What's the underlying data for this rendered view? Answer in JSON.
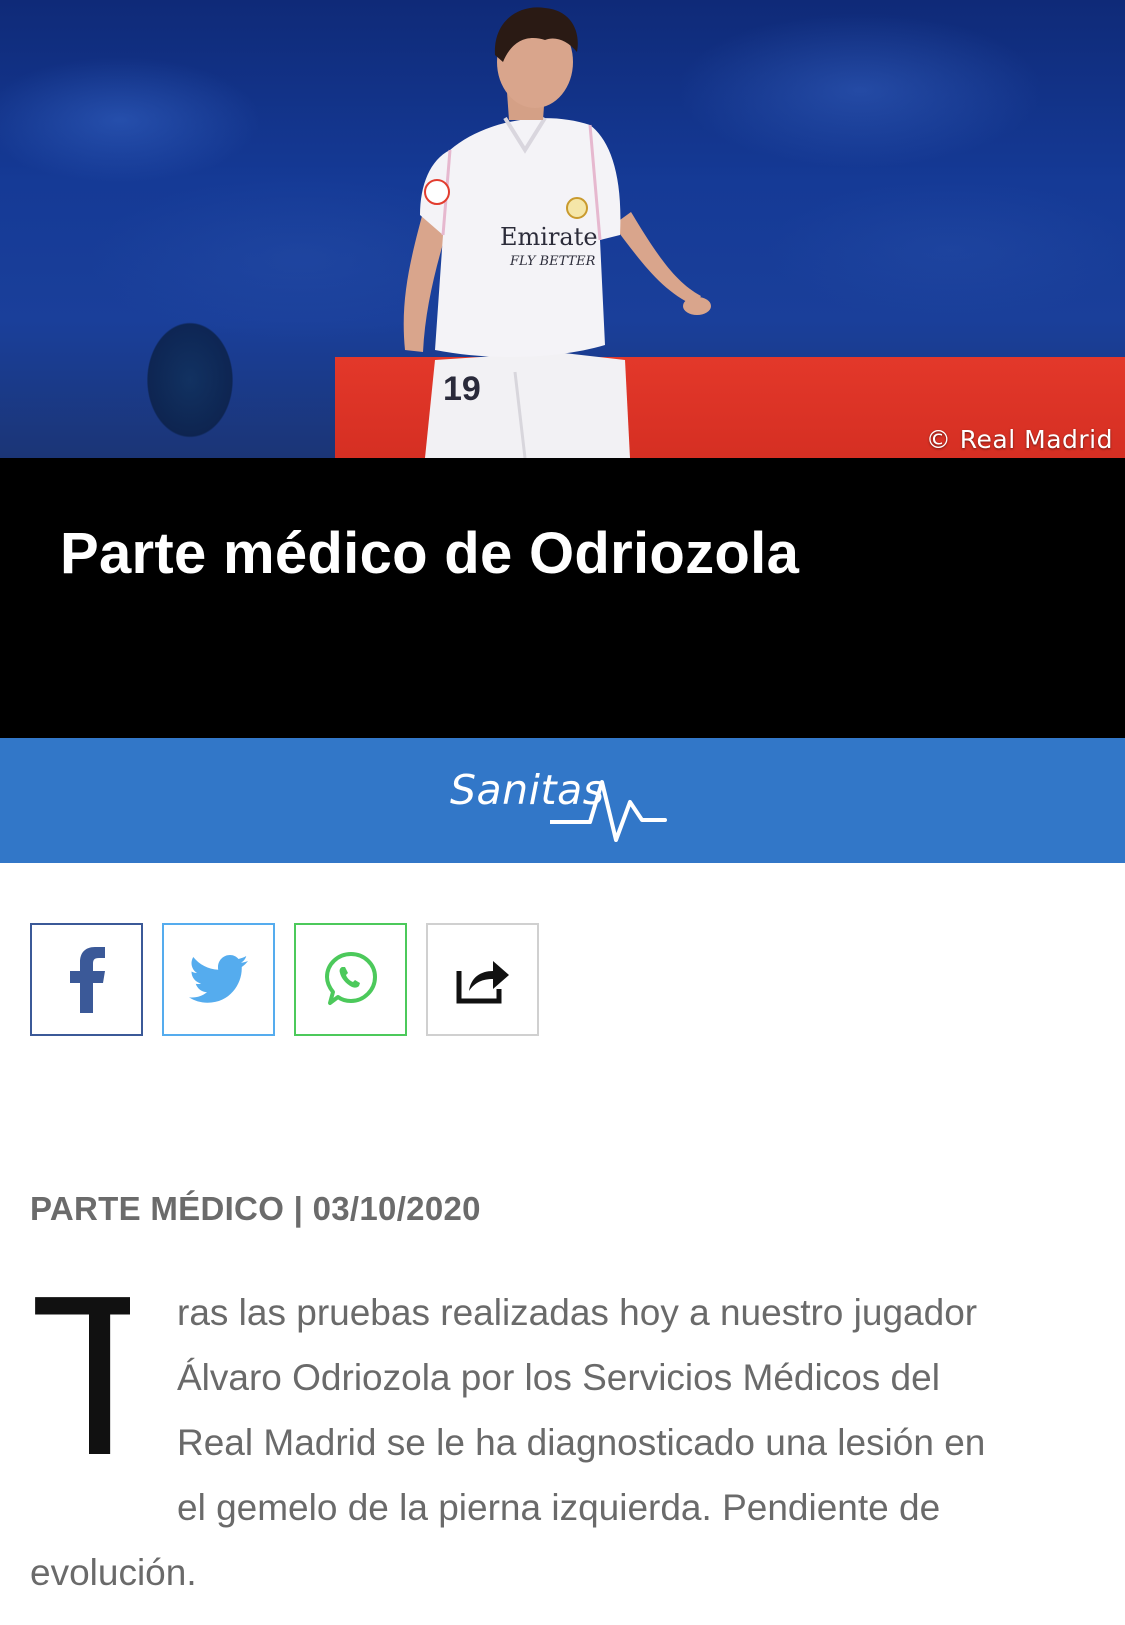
{
  "hero": {
    "credit": "© Real Madrid",
    "jersey_sponsor": "Emirates",
    "jersey_tagline": "FLY BETTER",
    "jersey_number": "19"
  },
  "article": {
    "title": "Parte médico de Odriozola",
    "meta": "PARTE MÉDICO | 03/10/2020",
    "dropcap": "T",
    "lines": [
      "ras las pruebas realizadas hoy a nuestro jugador",
      "Álvaro Odriozola por los Servicios Médicos del",
      "Real Madrid se le ha diagnosticado una lesión en",
      "el gemelo de la pierna izquierda. Pendiente de",
      "evolución."
    ]
  },
  "sponsor": {
    "name": "Sanitas",
    "bar_color": "#3277c8"
  },
  "share": {
    "buttons": [
      {
        "icon": "facebook-icon",
        "color": "#3b5998"
      },
      {
        "icon": "twitter-icon",
        "color": "#55acee"
      },
      {
        "icon": "whatsapp-icon",
        "color": "#4cc95b"
      },
      {
        "icon": "share-arrow-icon",
        "color": "#111111"
      }
    ]
  }
}
